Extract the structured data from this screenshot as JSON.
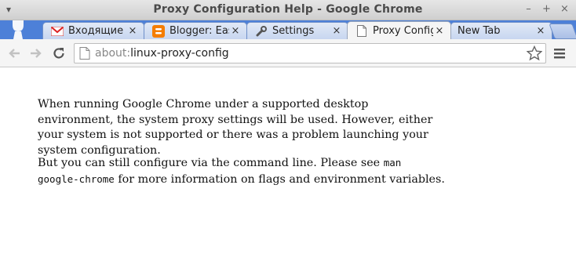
{
  "window": {
    "title": "Proxy Configuration Help - Google Chrome",
    "controls": {
      "minimize": "–",
      "maximize": "+",
      "close": "×"
    }
  },
  "tabs": [
    {
      "label": "Входящие - ",
      "icon": "gmail-icon",
      "active": false
    },
    {
      "label": "Blogger: Eas",
      "icon": "blogger-icon",
      "active": false
    },
    {
      "label": "Settings",
      "icon": "wrench-icon",
      "active": false
    },
    {
      "label": "Proxy Config",
      "icon": "page-icon",
      "active": true
    },
    {
      "label": "New Tab",
      "icon": "none",
      "active": false
    }
  ],
  "tab_close": "×",
  "omnibox": {
    "scheme": "about:",
    "path": "linux-proxy-config"
  },
  "content": {
    "paragraph1": "When running Google Chrome under a supported desktop environment, the system proxy settings will be used. However, either your system is not supported or there was a problem launching your system configuration.",
    "paragraph2_before": "But you can still configure via the command line. Please see ",
    "paragraph2_code": "man google-chrome",
    "paragraph2_after": " for more information on flags and environment variables."
  }
}
